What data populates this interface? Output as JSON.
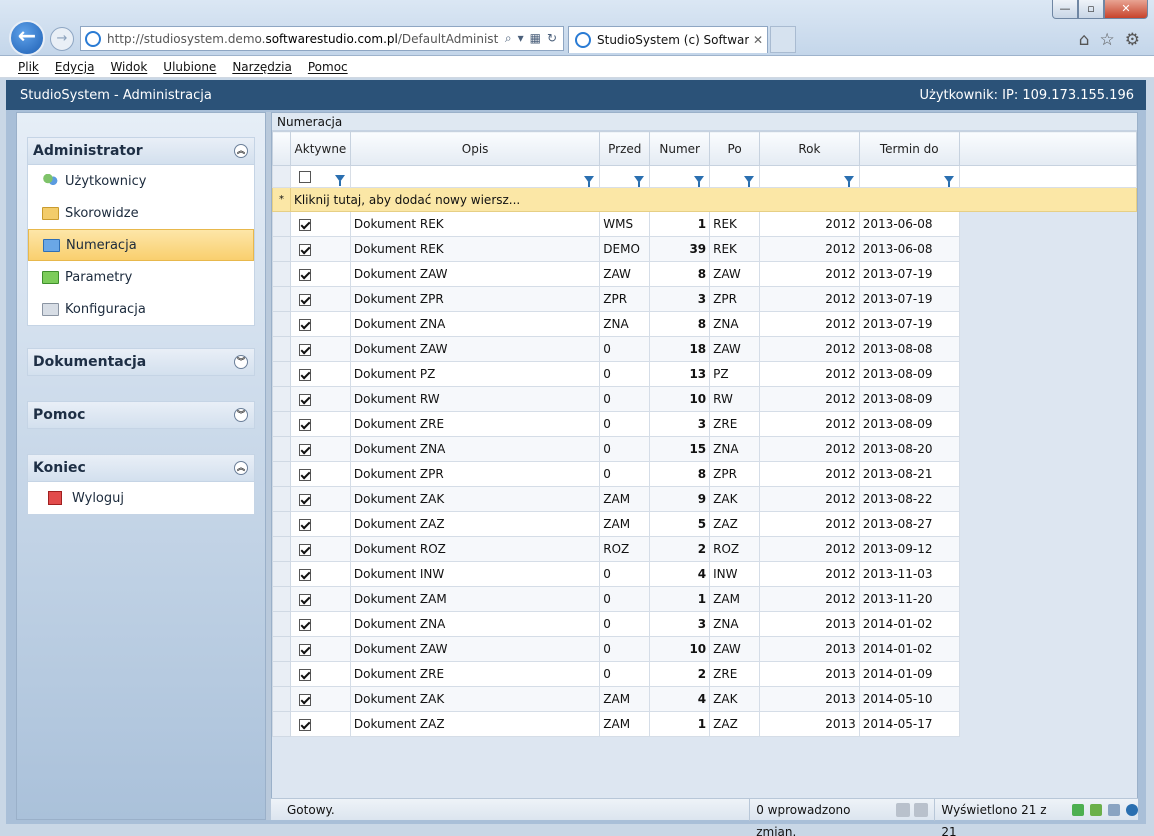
{
  "browser": {
    "address": "http://studiosystem.demo.softwarestudio.com.pl/DefaultAdministrator.as",
    "address_pre": "http://studiosystem.demo.",
    "address_bold": "softwarestudio.com.pl",
    "address_post": "/DefaultAdministrator.as",
    "tab_title": "StudioSystem (c) SoftwareS...",
    "tab_close": "✕",
    "win_min": "—",
    "win_max": "▫",
    "win_close": "✕"
  },
  "menu": [
    "Plik",
    "Edycja",
    "Widok",
    "Ulubione",
    "Narzędzia",
    "Pomoc"
  ],
  "app": {
    "title": "StudioSystem - Administracja",
    "user_label": "Użytkownik: IP: 109.173.155.196"
  },
  "sidebar": {
    "administrator": {
      "title": "Administrator",
      "items": [
        "Użytkownicy",
        "Skorowidze",
        "Numeracja",
        "Parametry",
        "Konfiguracja"
      ],
      "selected": "Numeracja"
    },
    "dokumentacja": {
      "title": "Dokumentacja"
    },
    "pomoc": {
      "title": "Pomoc"
    },
    "koniec": {
      "title": "Koniec",
      "items": [
        "Wyloguj"
      ]
    }
  },
  "grid": {
    "title": "Numeracja",
    "columns": [
      "Aktywne",
      "Opis",
      "Przed",
      "Numer",
      "Po",
      "Rok",
      "Termin do"
    ],
    "add_row_text": "Kliknij tutaj, aby dodać nowy wiersz...",
    "add_row_marker": "*",
    "rows": [
      {
        "opis": "Dokument REK",
        "przed": "WMS",
        "numer": "1",
        "po": "REK",
        "rok": "2012",
        "termin": "2013-06-08"
      },
      {
        "opis": "Dokument REK",
        "przed": "DEMO",
        "numer": "39",
        "po": "REK",
        "rok": "2012",
        "termin": "2013-06-08"
      },
      {
        "opis": "Dokument ZAW",
        "przed": "ZAW",
        "numer": "8",
        "po": "ZAW",
        "rok": "2012",
        "termin": "2013-07-19"
      },
      {
        "opis": "Dokument ZPR",
        "przed": "ZPR",
        "numer": "3",
        "po": "ZPR",
        "rok": "2012",
        "termin": "2013-07-19"
      },
      {
        "opis": "Dokument ZNA",
        "przed": "ZNA",
        "numer": "8",
        "po": "ZNA",
        "rok": "2012",
        "termin": "2013-07-19"
      },
      {
        "opis": "Dokument ZAW",
        "przed": "0",
        "numer": "18",
        "po": "ZAW",
        "rok": "2012",
        "termin": "2013-08-08"
      },
      {
        "opis": "Dokument PZ",
        "przed": "0",
        "numer": "13",
        "po": "PZ",
        "rok": "2012",
        "termin": "2013-08-09"
      },
      {
        "opis": "Dokument RW",
        "przed": "0",
        "numer": "10",
        "po": "RW",
        "rok": "2012",
        "termin": "2013-08-09"
      },
      {
        "opis": "Dokument ZRE",
        "przed": "0",
        "numer": "3",
        "po": "ZRE",
        "rok": "2012",
        "termin": "2013-08-09"
      },
      {
        "opis": "Dokument ZNA",
        "przed": "0",
        "numer": "15",
        "po": "ZNA",
        "rok": "2012",
        "termin": "2013-08-20"
      },
      {
        "opis": "Dokument ZPR",
        "przed": "0",
        "numer": "8",
        "po": "ZPR",
        "rok": "2012",
        "termin": "2013-08-21"
      },
      {
        "opis": "Dokument ZAK",
        "przed": "ZAM",
        "numer": "9",
        "po": "ZAK",
        "rok": "2012",
        "termin": "2013-08-22"
      },
      {
        "opis": "Dokument ZAZ",
        "przed": "ZAM",
        "numer": "5",
        "po": "ZAZ",
        "rok": "2012",
        "termin": "2013-08-27"
      },
      {
        "opis": "Dokument ROZ",
        "przed": "ROZ",
        "numer": "2",
        "po": "ROZ",
        "rok": "2012",
        "termin": "2013-09-12"
      },
      {
        "opis": "Dokument INW",
        "przed": "0",
        "numer": "4",
        "po": "INW",
        "rok": "2012",
        "termin": "2013-11-03"
      },
      {
        "opis": "Dokument ZAM",
        "przed": "0",
        "numer": "1",
        "po": "ZAM",
        "rok": "2012",
        "termin": "2013-11-20"
      },
      {
        "opis": "Dokument ZNA",
        "przed": "0",
        "numer": "3",
        "po": "ZNA",
        "rok": "2013",
        "termin": "2014-01-02"
      },
      {
        "opis": "Dokument ZAW",
        "przed": "0",
        "numer": "10",
        "po": "ZAW",
        "rok": "2013",
        "termin": "2014-01-02"
      },
      {
        "opis": "Dokument ZRE",
        "przed": "0",
        "numer": "2",
        "po": "ZRE",
        "rok": "2013",
        "termin": "2014-01-09"
      },
      {
        "opis": "Dokument ZAK",
        "przed": "ZAM",
        "numer": "4",
        "po": "ZAK",
        "rok": "2013",
        "termin": "2014-05-10"
      },
      {
        "opis": "Dokument ZAZ",
        "przed": "ZAM",
        "numer": "1",
        "po": "ZAZ",
        "rok": "2013",
        "termin": "2014-05-17"
      }
    ]
  },
  "status": {
    "ready": "Gotowy.",
    "changes": "0 wprowadzono zmian.",
    "displayed": "Wyświetlono 21 z 21"
  },
  "colors": {
    "header": "#2b5278",
    "selected": "#f9cf6e",
    "add_row": "#fbe7a6"
  }
}
